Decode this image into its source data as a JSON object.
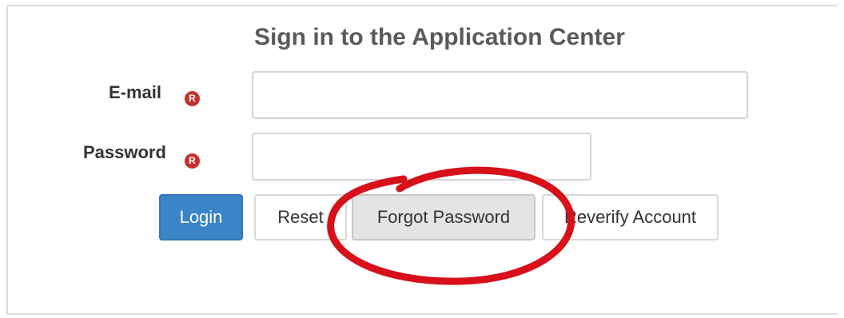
{
  "form": {
    "title": "Sign in to the Application Center",
    "email_label": "E-mail",
    "password_label": "Password",
    "required_mark": "R",
    "email_value": "",
    "password_value": ""
  },
  "buttons": {
    "login": "Login",
    "reset": "Reset",
    "forgot_password": "Forgot Password",
    "reverify_account": "Reverify Account"
  },
  "colors": {
    "primary": "#3a84c8",
    "required": "#c9302c",
    "annotation_circle": "#d8101a"
  }
}
